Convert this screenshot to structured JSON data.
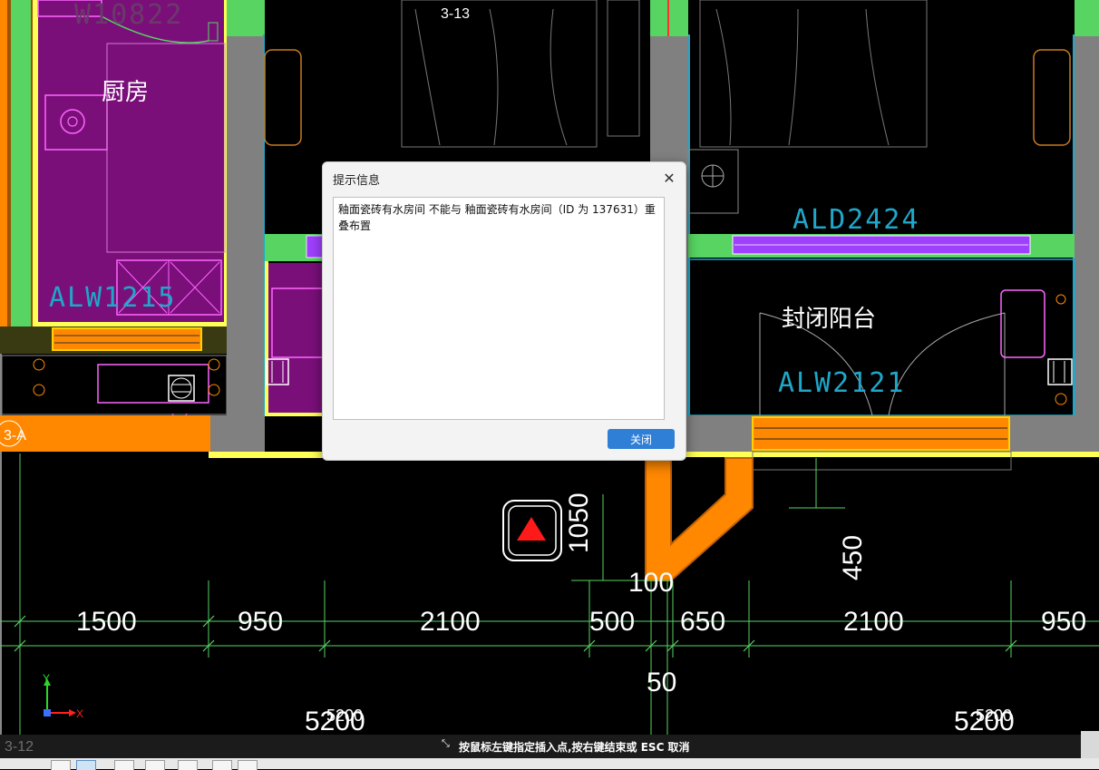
{
  "drawing": {
    "axis_labels": {
      "top": "3-13",
      "left": "3-A",
      "bottom_left": "3-12"
    },
    "room_labels": {
      "kitchen": "厨房",
      "balcony": "封闭阳台"
    },
    "window_tags": {
      "kitchen_window": "ALW1215",
      "top_window": "W10822",
      "door_tag": "ALD2424",
      "balcony_window": "ALW2121"
    },
    "dimensions": {
      "d1": "1500",
      "d2": "950",
      "d3": "2100",
      "d4": "500",
      "d5": "650",
      "d6": "2100",
      "d7": "950",
      "small_100": "100",
      "small_50": "50",
      "vert_1050": "1050",
      "vert_450": "450",
      "total_left": "5200",
      "total_left_overlay": "5200",
      "total_right": "5200",
      "total_right_overlay": "5200"
    },
    "ucs": {
      "y": "Y",
      "x": "X"
    }
  },
  "dialog": {
    "title": "提示信息",
    "message": "釉面瓷砖有水房间 不能与 釉面瓷砖有水房间（ID 为 137631）重叠布置",
    "close_button": "关闭",
    "close_icon": "✕"
  },
  "status": {
    "prompt": "按鼠标左键指定插入点,按右键结束或 ESC 取消"
  },
  "colors": {
    "purple": "#7a0f7a",
    "orange": "#ff8800",
    "green": "#57d462",
    "gray": "#808080",
    "blue_text": "#1fa7c9",
    "accent_button": "#2f7fd6"
  }
}
